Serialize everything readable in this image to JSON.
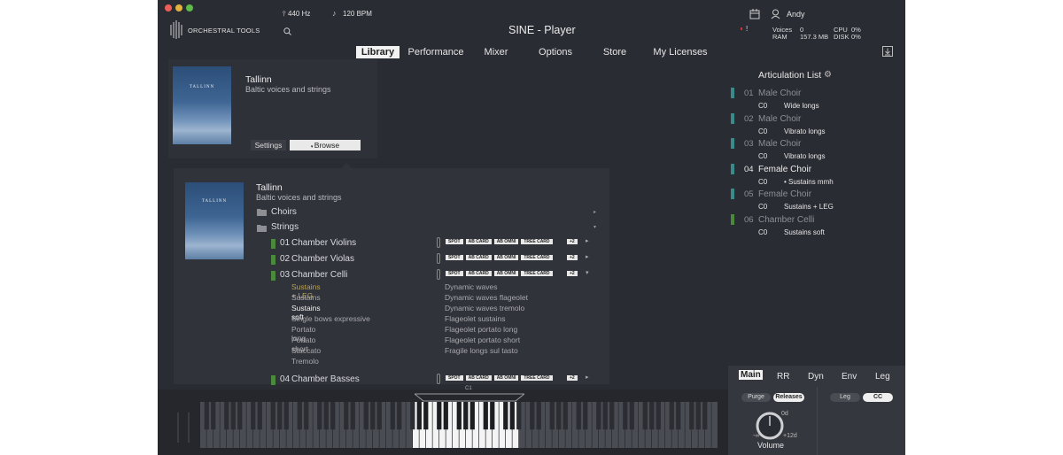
{
  "window": {
    "title": "SINE - Player",
    "brand": "ORCHESTRAL TOOLS",
    "tuning": "440 Hz",
    "tempo": "120 BPM",
    "user": "Andy"
  },
  "stats": {
    "voices_label": "Voices",
    "voices_value": "0",
    "ram_label": "RAM",
    "ram_value": "157.3 MB",
    "cpu_label": "CPU",
    "cpu_value": "0%",
    "disk_label": "DISK",
    "disk_value": "0%"
  },
  "tabs": [
    "Library",
    "Performance",
    "Mixer",
    "Options",
    "Store",
    "My Licenses"
  ],
  "top_panel": {
    "title": "Tallinn",
    "subtitle": "Baltic voices and strings",
    "settings": "Settings",
    "browse": "Browse",
    "cover_text": "TALLINN"
  },
  "library": {
    "title": "Tallinn",
    "subtitle": "Baltic voices and strings",
    "cover_text": "TALLINN",
    "folders": [
      "Choirs",
      "Strings"
    ],
    "instruments": [
      {
        "num": "01",
        "name": "Chamber Violins",
        "tags": [
          "SPOT",
          "AB CARD",
          "AB OMNI",
          "TREE CARD"
        ],
        "more": "+2"
      },
      {
        "num": "02",
        "name": "Chamber Violas",
        "tags": [
          "SPOT",
          "AB CARD",
          "AB OMNI",
          "TREE CARD"
        ],
        "more": "+2"
      },
      {
        "num": "03",
        "name": "Chamber Celli",
        "tags": [
          "SPOT",
          "AB CARD",
          "AB OMNI",
          "TREE CARD"
        ],
        "more": "+2"
      },
      {
        "num": "04",
        "name": "Chamber Basses",
        "tags": [
          "SPOT",
          "AB CARD",
          "AB OMNI",
          "TREE CARD"
        ],
        "more": "+2"
      }
    ],
    "articulations_left": [
      "Sustains + LEG",
      "Sustains",
      "Sustains soft",
      "Single bows expressive",
      "Portato long",
      "Portato short",
      "Staccato",
      "Tremolo"
    ],
    "articulations_right": [
      "Dynamic waves",
      "Dynamic waves flageolet",
      "Dynamic waves tremolo",
      "Flageolet sustains",
      "Flageolet portato long",
      "Flageolet portato short",
      "Fragile longs sul tasto"
    ]
  },
  "articulation_list": {
    "title": "Articulation List",
    "items": [
      {
        "num": "01",
        "name": "Male Choir",
        "key": "C0",
        "art": "Wide longs",
        "color": "#3a8a8c",
        "active": false
      },
      {
        "num": "02",
        "name": "Male Choir",
        "key": "C0",
        "art": "Vibrato longs",
        "color": "#3a8a8c",
        "active": false
      },
      {
        "num": "03",
        "name": "Male Choir",
        "key": "C0",
        "art": "Vibrato longs",
        "color": "#3a8a8c",
        "active": false
      },
      {
        "num": "04",
        "name": "Female Choir",
        "key": "C0",
        "art": "• Sustains mmh",
        "color": "#3a8a8c",
        "active": true
      },
      {
        "num": "05",
        "name": "Female Choir",
        "key": "C0",
        "art": "Sustains + LEG",
        "color": "#3a8a8c",
        "active": false
      },
      {
        "num": "06",
        "name": "Chamber Celli",
        "key": "C0",
        "art": "Sustains soft",
        "color": "#4b8a3c",
        "active": false
      }
    ]
  },
  "bottom_tabs": [
    "Main",
    "RR",
    "Dyn",
    "Env",
    "Leg"
  ],
  "controls": {
    "purge": "Purge",
    "releases": "Releases",
    "leg": "Leg",
    "cc": "CC",
    "volume_label": "Volume",
    "vol_max": "0d",
    "vol_plus": "+12d",
    "vol_min": "-∞"
  },
  "keyboard": {
    "octave_marker": "C1"
  }
}
